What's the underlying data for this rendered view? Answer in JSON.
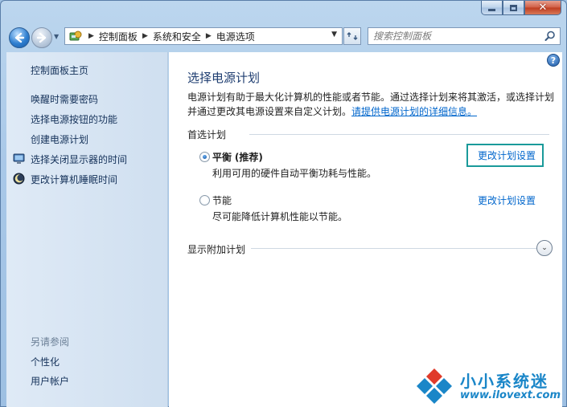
{
  "window": {
    "caption": {
      "minimize": "minimize",
      "maximize": "maximize",
      "close": "✕"
    }
  },
  "address": {
    "breadcrumbs": [
      "控制面板",
      "系统和安全",
      "电源选项"
    ]
  },
  "search": {
    "placeholder": "搜索控制面板"
  },
  "sidebar": {
    "items": [
      {
        "label": "控制面板主页"
      },
      {
        "label": "唤醒时需要密码"
      },
      {
        "label": "选择电源按钮的功能"
      },
      {
        "label": "创建电源计划"
      },
      {
        "label": "选择关闭显示器的时间",
        "icon": "monitor-icon"
      },
      {
        "label": "更改计算机睡眠时间",
        "icon": "moon-icon"
      }
    ],
    "see_also_title": "另请参阅",
    "see_also": [
      {
        "label": "个性化"
      },
      {
        "label": "用户帐户"
      }
    ]
  },
  "main": {
    "title": "选择电源计划",
    "intro": "电源计划有助于最大化计算机的性能或者节能。通过选择计划来将其激活，或选择计划并通过更改其电源设置来自定义计划。",
    "intro_link": "请提供电源计划的详细信息。",
    "section_label": "首选计划",
    "plans": [
      {
        "name": "平衡",
        "tag": "(推荐)",
        "description": "利用可用的硬件自动平衡功耗与性能。",
        "link": "更改计划设置",
        "selected": true
      },
      {
        "name": "节能",
        "tag": "",
        "description": "尽可能降低计算机性能以节能。",
        "link": "更改计划设置",
        "selected": false
      }
    ],
    "show_additional": "显示附加计划"
  },
  "watermark": {
    "text": "小小系统迷",
    "url": "www.ilovext.com"
  },
  "colors": {
    "link": "#0066cc",
    "title": "#1e3d70",
    "highlight_box": "#1a9a9a"
  }
}
